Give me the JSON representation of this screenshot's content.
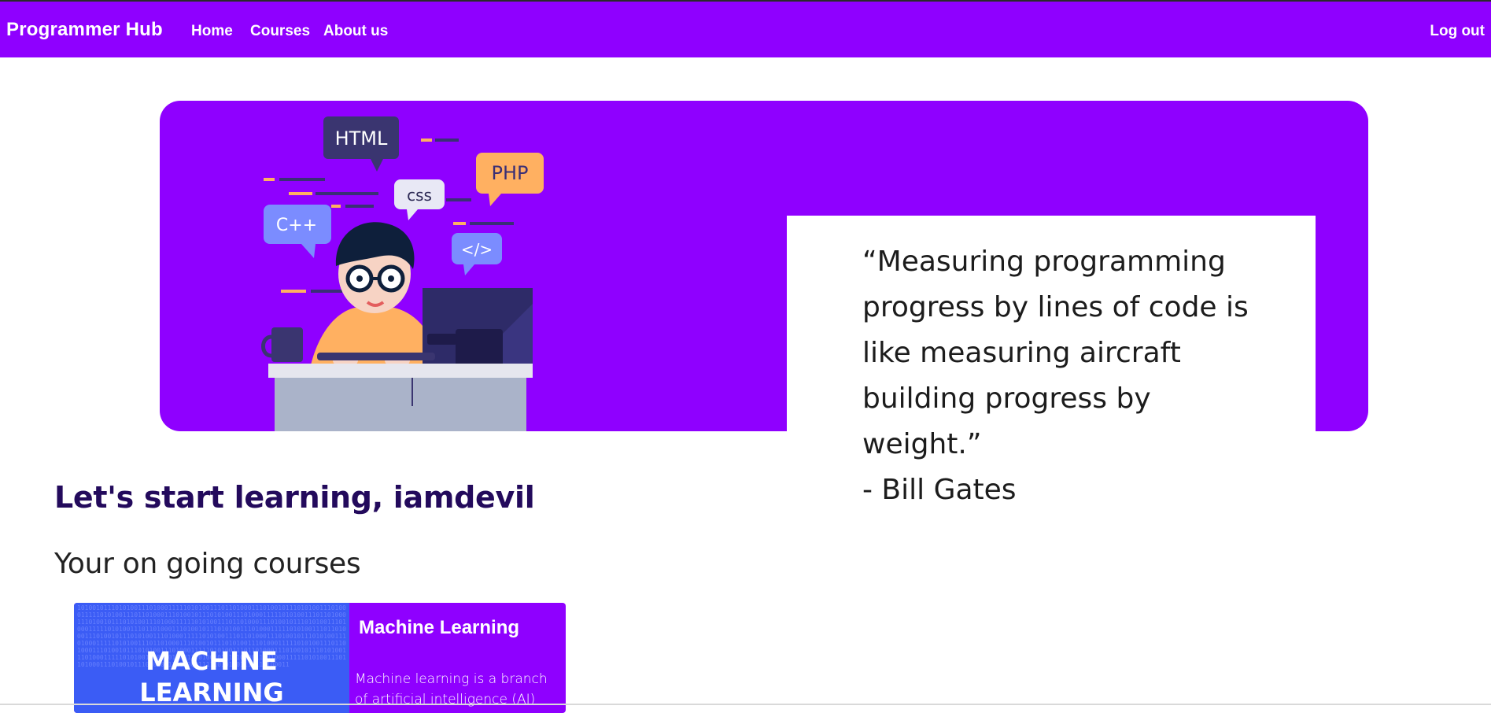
{
  "navbar": {
    "brand": "Programmer Hub",
    "links": [
      "Home",
      "Courses",
      "About us"
    ],
    "logout": "Log out",
    "color": "#8f00ff"
  },
  "hero": {
    "illustration_icon": "programmer-at-desk-illustration",
    "bubbles": {
      "html": "HTML",
      "css": "css",
      "php": "PHP",
      "cpp": "C++",
      "code": "</>"
    },
    "quote": "“Measuring programming\nprogress by lines of code is\nlike measuring aircraft\nbuilding progress by weight.”\n- Bill Gates"
  },
  "welcome": "Let's start learning, iamdevil",
  "ongoing_heading": "Your on going courses",
  "courses": [
    {
      "thumbnail_text": "MACHINE\nLEARNING",
      "title": "Machine Learning",
      "description": "Machine learning is a branch of artificial intelligence (AI) and"
    }
  ]
}
